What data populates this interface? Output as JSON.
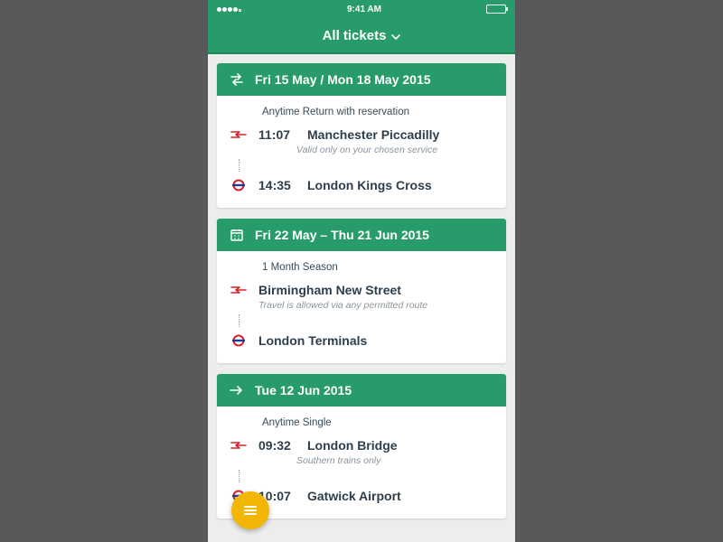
{
  "statusbar": {
    "time": "9:41 AM"
  },
  "navbar": {
    "title": "All tickets"
  },
  "tickets": [
    {
      "icon": "swap",
      "date_range": "Fri 15 May / Mon 18 May 2015",
      "type": "Anytime Return with reservation",
      "origin": {
        "time": "11:07",
        "station": "Manchester Piccadilly",
        "icon": "nr"
      },
      "note": "Valid only on your chosen service",
      "destination": {
        "time": "14:35",
        "station": "London Kings Cross",
        "icon": "tube"
      },
      "show_times": true
    },
    {
      "icon": "calendar",
      "date_range": "Fri 22 May – Thu 21 Jun 2015",
      "type": "1 Month Season",
      "origin": {
        "time": "",
        "station": "Birmingham New Street",
        "icon": "nr"
      },
      "note": "Travel is allowed via any permitted route",
      "destination": {
        "time": "",
        "station": "London Terminals",
        "icon": "tube"
      },
      "show_times": false
    },
    {
      "icon": "arrow",
      "date_range": "Tue 12 Jun 2015",
      "type": "Anytime Single",
      "origin": {
        "time": "09:32",
        "station": "London Bridge",
        "icon": "nr"
      },
      "note": "Southern trains only",
      "destination": {
        "time": "10:07",
        "station": "Gatwick Airport",
        "icon": "tube"
      },
      "show_times": true
    }
  ]
}
